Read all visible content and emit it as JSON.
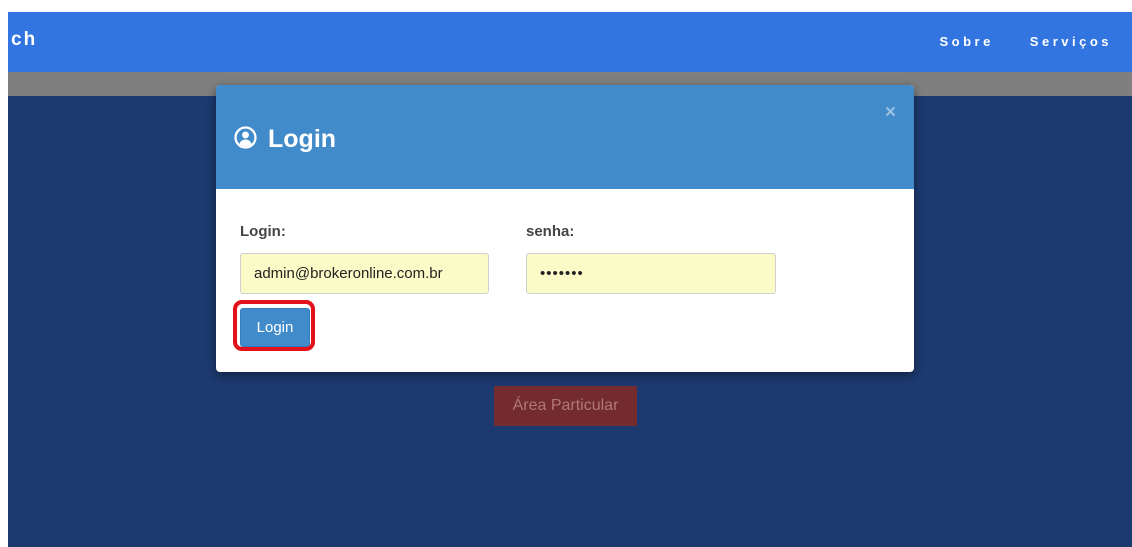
{
  "navbar": {
    "brand": "ch",
    "links": [
      {
        "label": "Sobre"
      },
      {
        "label": "Serviços"
      }
    ]
  },
  "background": {
    "area_button_label": "Área Particular"
  },
  "modal": {
    "title": "Login",
    "title_icon": "user-circle-icon",
    "close_label": "×",
    "login_label": "Login:",
    "login_value": "admin@brokeronline.com.br",
    "password_label": "senha:",
    "password_value": "•••••••",
    "submit_label": "Login"
  },
  "colors": {
    "navbar": "#3274e0",
    "page_bg": "#1c3a70",
    "modal_header": "#428bca",
    "input_bg": "#fafbc6",
    "area_button": "#732b2e",
    "highlight": "#e4101a"
  }
}
